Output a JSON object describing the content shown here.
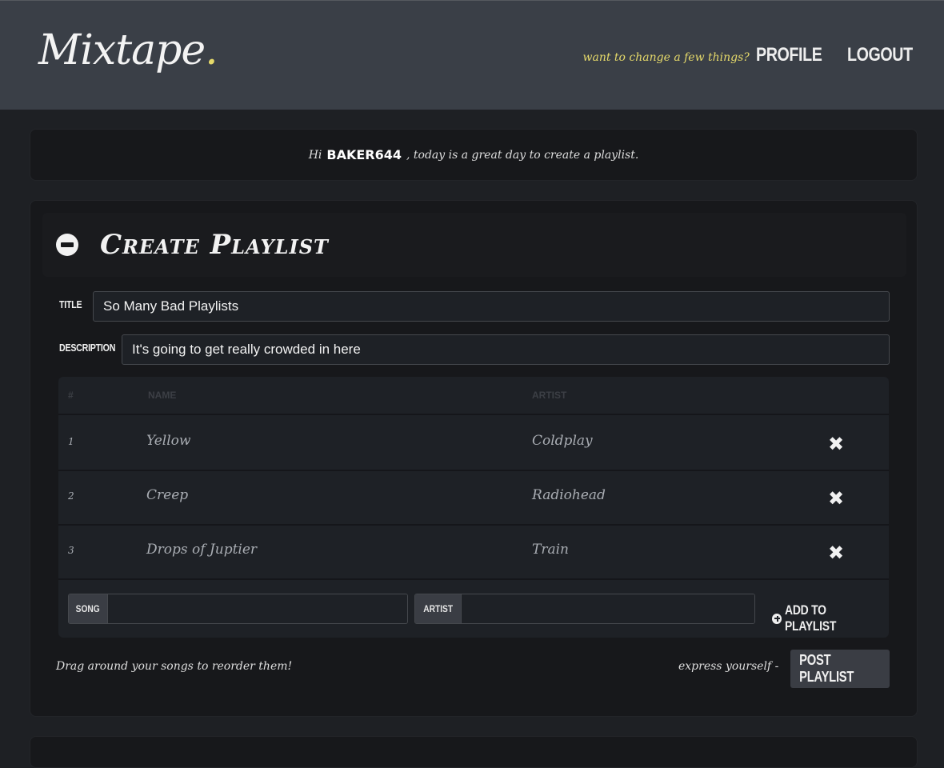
{
  "header": {
    "logo_text": "Mixtape",
    "logo_dot": ".",
    "tagline": "want to change a few things?",
    "profile_label": "PROFILE",
    "logout_label": "LOGOUT"
  },
  "greeting": {
    "prefix": "Hi",
    "username": "BAKER644",
    "suffix": ", today is a great day to create a playlist."
  },
  "create_playlist": {
    "heading": "Create Playlist",
    "title_label": "TITLE",
    "title_value": "So Many Bad Playlists",
    "description_label": "DESCRIPTION",
    "description_value": "It's going to get really crowded in here",
    "table": {
      "headers": [
        "#",
        "NAME",
        "ARTIST"
      ],
      "rows": [
        {
          "num": "1",
          "name": "Yellow",
          "artist": "Coldplay"
        },
        {
          "num": "2",
          "name": "Creep",
          "artist": "Radiohead"
        },
        {
          "num": "3",
          "name": "Drops of Juptier",
          "artist": "Train"
        }
      ],
      "remove_glyph": "✖"
    },
    "add_song": {
      "song_label": "SONG",
      "artist_label": "ARTIST",
      "song_value": "",
      "artist_value": "",
      "add_label": "ADD TO PLAYLIST"
    },
    "hint": "Drag around your songs to reorder them!",
    "express": "express yourself -",
    "post_label": "POST PLAYLIST"
  },
  "colors": {
    "accent": "#e5d96a",
    "header_bg": "#3a3f47",
    "page_bg": "#1e2024",
    "panel_bg": "#17181b"
  }
}
